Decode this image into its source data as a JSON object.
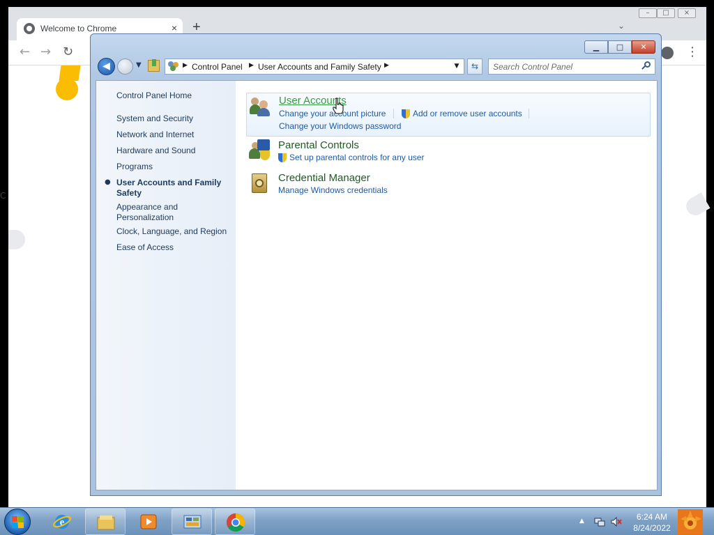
{
  "chrome": {
    "tab_title": "Welcome to Chrome",
    "tab_close": "×",
    "new_tab": "+",
    "tab_dropdown": "⌄",
    "back": "←",
    "forward": "→",
    "reload": "↻",
    "menu": "⋮",
    "edge_letter": "C"
  },
  "control_panel": {
    "caption": {
      "minimize": "▁",
      "maximize": "□",
      "close": "✕"
    },
    "nav": {
      "back": "◀",
      "history_dropdown": "▼"
    },
    "breadcrumb": [
      "Control Panel",
      "User Accounts and Family Safety"
    ],
    "breadcrumb_sep": "▶",
    "address_dropdown": "▼",
    "refresh": "⇆",
    "search_placeholder": "Search Control Panel",
    "left_pane": {
      "home": "Control Panel Home",
      "items": [
        "System and Security",
        "Network and Internet",
        "Hardware and Sound",
        "Programs",
        "User Accounts and Family Safety",
        "Appearance and Personalization",
        "Clock, Language, and Region",
        "Ease of Access"
      ],
      "current_bullet": "●"
    },
    "categories": [
      {
        "title": "User Accounts",
        "links": [
          "Change your account picture",
          "Add or remove user accounts",
          "Change your Windows password"
        ]
      },
      {
        "title": "Parental Controls",
        "links": [
          "Set up parental controls for any user"
        ]
      },
      {
        "title": "Credential Manager",
        "links": [
          "Manage Windows credentials"
        ]
      }
    ]
  },
  "taskbar": {
    "time": "6:24 AM",
    "date": "8/24/2022",
    "tray_arrow": "▲"
  },
  "colors": {
    "link_blue": "#1e5aa8",
    "category_green": "#1e5a24",
    "hover_green": "#3b9a43",
    "left_pane_text": "#1e395b"
  }
}
